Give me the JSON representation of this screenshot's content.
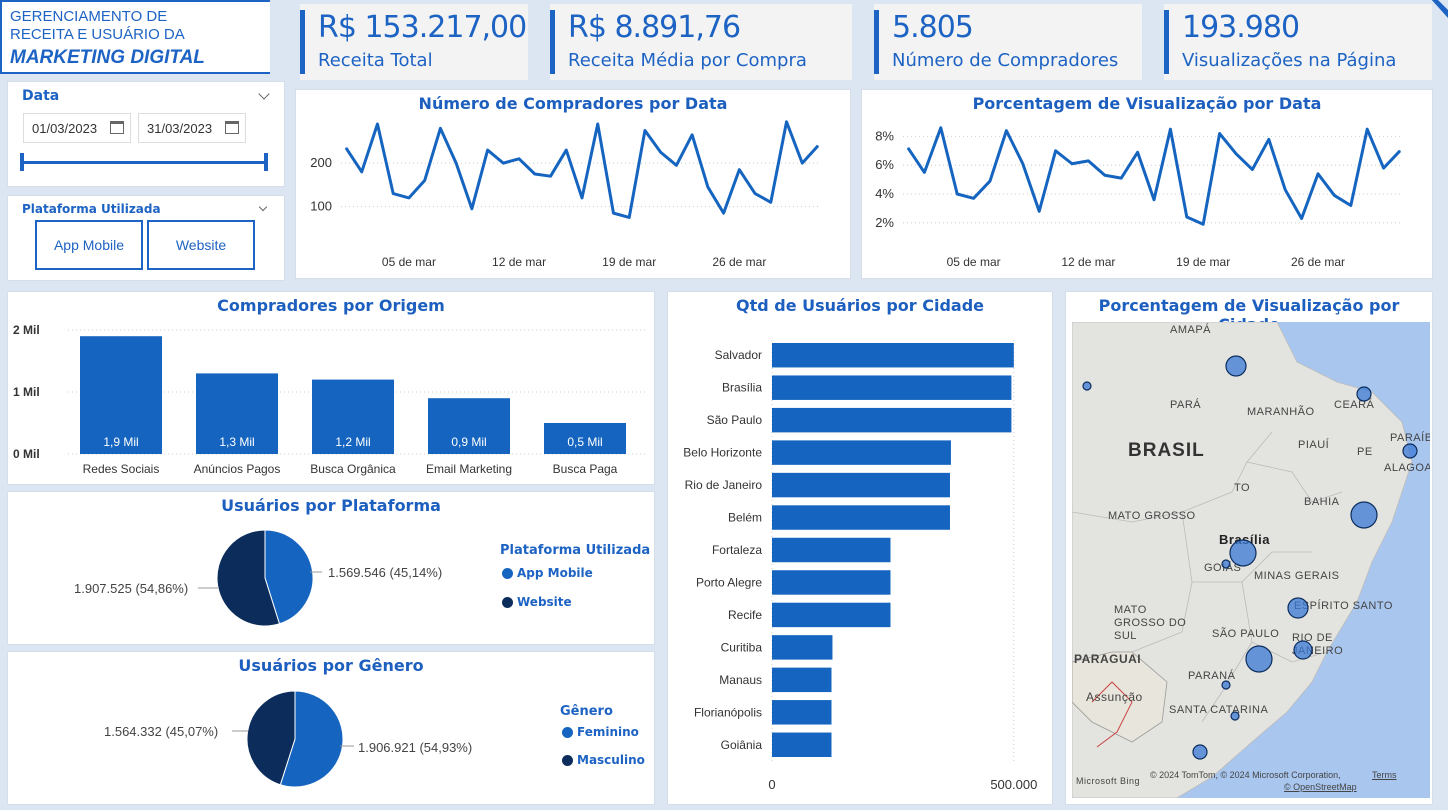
{
  "header": {
    "title_line1": "GERENCIAMENTO DE",
    "title_line2": "RECEITA E USUÁRIO DA",
    "title_line3": "MARKETING DIGITAL"
  },
  "kpis": [
    {
      "value": "R$ 153.217,00",
      "label": "Receita Total"
    },
    {
      "value": "R$ 8.891,76",
      "label": "Receita Média por Compra"
    },
    {
      "value": "5.805",
      "label": "Número de Compradores"
    },
    {
      "value": "193.980",
      "label": "Visualizações na Página"
    }
  ],
  "date_slicer": {
    "title": "Data",
    "start": "01/03/2023",
    "end": "31/03/2023"
  },
  "platform_slicer": {
    "title": "Plataforma Utilizada",
    "options": [
      "App Mobile",
      "Website"
    ]
  },
  "colors": {
    "accent": "#1d63c4",
    "dark": "#0c2d5c",
    "bar": "#1565c0"
  },
  "chart_data": [
    {
      "id": "buyers_by_date",
      "type": "line",
      "title": "Número de Compradores por Data",
      "x_ticks": [
        "05 de mar",
        "12 de mar",
        "19 de mar",
        "26 de mar"
      ],
      "y_ticks": [
        "100",
        "200"
      ],
      "ylim": [
        60,
        290
      ],
      "values": [
        235,
        180,
        290,
        130,
        120,
        160,
        280,
        200,
        95,
        230,
        200,
        210,
        175,
        170,
        230,
        120,
        290,
        85,
        75,
        275,
        225,
        195,
        265,
        145,
        85,
        185,
        130,
        110,
        295,
        200,
        240
      ]
    },
    {
      "id": "view_pct_by_date",
      "type": "line",
      "title": "Porcentagem de Visualização por Data",
      "x_ticks": [
        "05 de mar",
        "12 de mar",
        "19 de mar",
        "26 de mar"
      ],
      "y_ticks": [
        "2%",
        "4%",
        "6%",
        "8%"
      ],
      "ylim": [
        1.5,
        9
      ],
      "values": [
        7.2,
        5.5,
        8.6,
        4.0,
        3.7,
        4.9,
        8.4,
        6.1,
        2.8,
        7.0,
        6.1,
        6.3,
        5.3,
        5.1,
        6.9,
        3.6,
        8.5,
        2.4,
        1.9,
        8.2,
        6.8,
        5.7,
        7.8,
        4.3,
        2.3,
        5.4,
        3.9,
        3.2,
        8.5,
        5.8,
        7.0
      ]
    },
    {
      "id": "buyers_by_origin",
      "type": "bar",
      "title": "Compradores por Origem",
      "categories": [
        "Redes Sociais",
        "Anúncios Pagos",
        "Busca Orgânica",
        "Email Marketing",
        "Busca Paga"
      ],
      "values": [
        1.9,
        1.3,
        1.2,
        0.9,
        0.5
      ],
      "data_labels": [
        "1,9 Mil",
        "1,3 Mil",
        "1,2 Mil",
        "0,9 Mil",
        "0,5 Mil"
      ],
      "y_ticks": [
        "0 Mil",
        "1 Mil",
        "2 Mil"
      ],
      "ylim": [
        0,
        2
      ]
    },
    {
      "id": "users_by_platform",
      "type": "pie",
      "title": "Usuários por Plataforma",
      "legend_title": "Plataforma Utilizada",
      "slices": [
        {
          "name": "App Mobile",
          "value": 1569546,
          "label": "1.569.546 (45,14%)",
          "color": "#1565c0"
        },
        {
          "name": "Website",
          "value": 1907525,
          "label": "1.907.525 (54,86%)",
          "color": "#0c2d5c"
        }
      ]
    },
    {
      "id": "users_by_gender",
      "type": "pie",
      "title": "Usuários por Gênero",
      "legend_title": "Gênero",
      "slices": [
        {
          "name": "Feminino",
          "value": 1906921,
          "label": "1.906.921 (54,93%)",
          "color": "#1565c0"
        },
        {
          "name": "Masculino",
          "value": 1564332,
          "label": "1.564.332 (45,07%)",
          "color": "#0c2d5c"
        }
      ]
    },
    {
      "id": "users_by_city",
      "type": "bar",
      "orientation": "horizontal",
      "title": "Qtd de Usuários por Cidade",
      "categories": [
        "Salvador",
        "Brasília",
        "São Paulo",
        "Belo Horizonte",
        "Rio de Janeiro",
        "Belém",
        "Fortaleza",
        "Porto Alegre",
        "Recife",
        "Curitiba",
        "Manaus",
        "Florianópolis",
        "Goiânia"
      ],
      "values": [
        500000,
        495000,
        495000,
        370000,
        368000,
        368000,
        245000,
        245000,
        245000,
        125000,
        123000,
        123000,
        123000
      ],
      "x_ticks": [
        "0",
        "500.000"
      ],
      "xlim": [
        0,
        550000
      ]
    }
  ],
  "map": {
    "title": "Porcentagem de Visualização por Cidade",
    "country_label": "BRASIL",
    "region_labels": [
      "AMAPÁ",
      "PARÁ",
      "MARANHÃO",
      "CEARÁ",
      "PIAUÍ",
      "PARAÍBA",
      "PE",
      "ALAGOAS",
      "TO",
      "BAHIA",
      "MATO GROSSO",
      "Brasília",
      "GOIÁS",
      "MINAS GERAIS",
      "ESPÍRITO SANTO",
      "MATO GROSSO DO SUL",
      "SÃO PAULO",
      "RIO DE JANEIRO",
      "PARAGUAI",
      "Assunção",
      "PARANÁ",
      "SANTA CATARINA"
    ],
    "attribution": "© 2024 TomTom, © 2024 Microsoft Corporation,",
    "terms": "Terms",
    "osm": "© OpenStreetMap",
    "bing": "Microsoft Bing"
  }
}
